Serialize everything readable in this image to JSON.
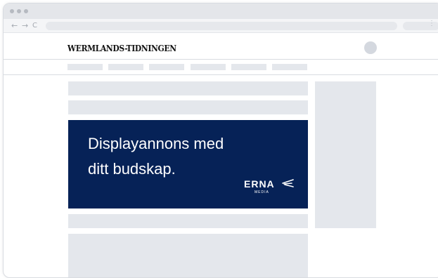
{
  "browser": {
    "back_glyph": "←",
    "forward_glyph": "→",
    "reload_glyph": "C",
    "menu_glyph": "⋮"
  },
  "site": {
    "logo": "WERMLANDS-TIDNINGEN"
  },
  "ad": {
    "headline_line1": "Displayannons med",
    "headline_line2": "ditt budskap.",
    "brand_name": "ERNA",
    "brand_sub": "MEDIA",
    "background_color": "#062257",
    "text_color": "#ffffff"
  },
  "colors": {
    "placeholder": "#e4e7ec",
    "chrome": "#e4e6ea"
  }
}
